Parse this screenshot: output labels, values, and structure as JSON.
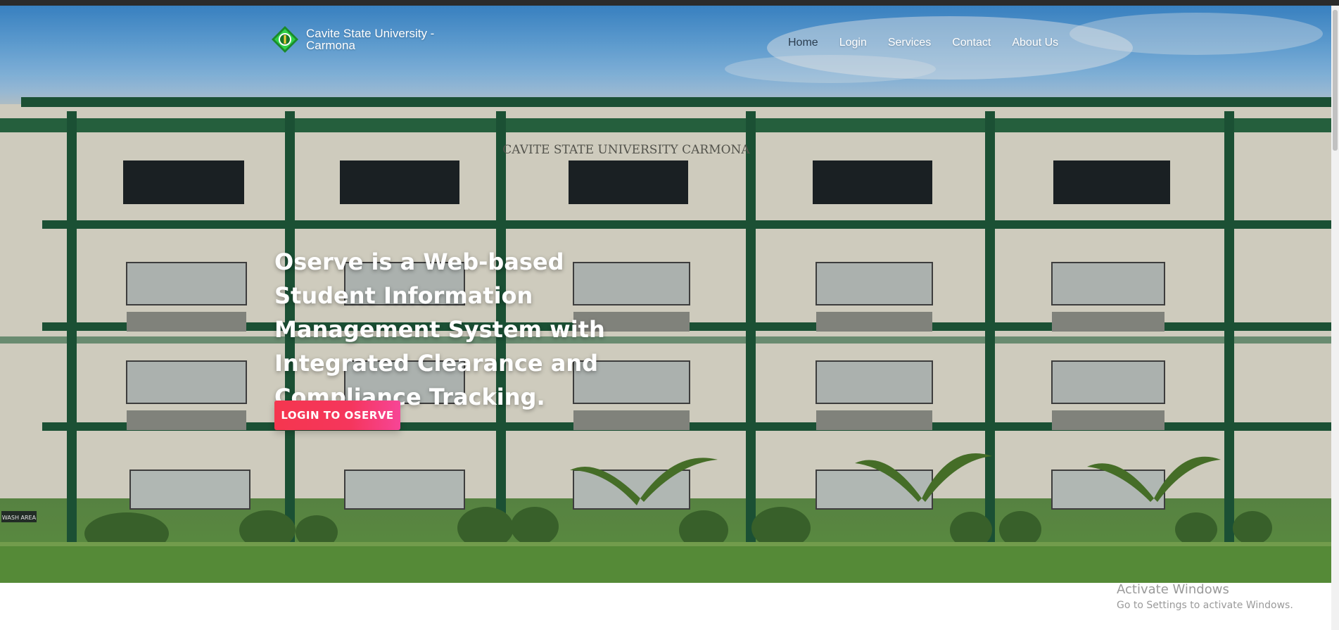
{
  "brand": {
    "name": "Cavite State University - Carmona",
    "logo_icon": "university-seal-icon"
  },
  "nav": {
    "items": [
      {
        "label": "Home"
      },
      {
        "label": "Login"
      },
      {
        "label": "Services"
      },
      {
        "label": "Contact"
      },
      {
        "label": "About Us"
      }
    ]
  },
  "hero": {
    "building_sign": "CAVITE STATE UNIVERSITY CARMONA",
    "side_sign": "WASH AREA",
    "headline": "Oserve is a Web-based Student Information Management System with Integrated Clearance and Compliance Tracking.",
    "cta_label": "LOGIN TO OSERVE"
  },
  "watermark": {
    "title": "Activate Windows",
    "subtitle": "Go to Settings to activate Windows."
  },
  "colors": {
    "accent": "#f5365c",
    "nav_active": "#2b3d4f",
    "building_green": "#1f5a3a"
  }
}
